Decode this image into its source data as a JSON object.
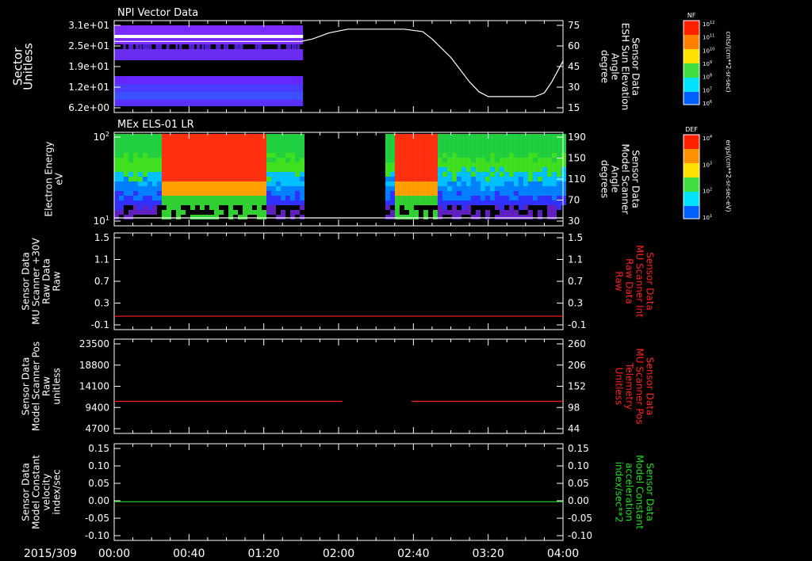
{
  "date_label": "2015/309",
  "time_ticks": [
    "00:00",
    "00:40",
    "01:20",
    "02:00",
    "02:40",
    "03:20",
    "04:00"
  ],
  "colors": {
    "axis": "#ffffff",
    "red": "#ff2020",
    "green": "#20e020",
    "white": "#ffffff"
  },
  "chart_data": [
    {
      "type": "heatmap",
      "title": "NPI Vector Data",
      "ylabel": [
        "Sector",
        "Unitless"
      ],
      "yticks": [
        "3.1e+01",
        "2.5e+01",
        "1.9e+01",
        "1.2e+01",
        "6.2e+00"
      ],
      "overlay": {
        "type": "line",
        "ylabel": [
          "Sensor Data",
          "ESH Sun Elevation",
          "Angle",
          "degree"
        ],
        "yticks": [
          "75",
          "60",
          "45",
          "30",
          "15"
        ],
        "ylim": [
          0,
          75
        ],
        "x_minutes": [
          0,
          100,
          106,
          115,
          125,
          140,
          145,
          155,
          165,
          170,
          180,
          190,
          195,
          200,
          210,
          220,
          225,
          230,
          234,
          240
        ],
        "y": [
          58,
          58,
          60,
          65,
          68,
          68,
          68,
          68,
          66,
          60,
          45,
          25,
          17,
          13,
          13,
          13,
          13,
          16,
          25,
          42
        ]
      },
      "colorbar": {
        "label": "NF",
        "units": "cnts/(cm**2-sr-sec)",
        "ticks": [
          "10^12",
          "10^11",
          "10^10",
          "10^9",
          "10^8",
          "10^7",
          "10^6"
        ]
      }
    },
    {
      "type": "heatmap",
      "title": "MEx ELS-01 LR",
      "ylabel": [
        "Electron Energy",
        "eV"
      ],
      "yticks": [
        "10^2",
        "10^1"
      ],
      "overlay": {
        "type": "line",
        "ylabel": [
          "Sensor Data",
          "Model Scanner",
          "Angle",
          "degrees"
        ],
        "yticks": [
          "190",
          "150",
          "110",
          "70",
          "30"
        ],
        "ylim": [
          0,
          190
        ],
        "x_minutes": [
          0,
          240
        ],
        "y": [
          0,
          0
        ]
      },
      "colorbar": {
        "label": "DEF",
        "units": "ergs/(cm**2-sr-sec-eV)",
        "ticks": [
          "10^4",
          "10^3",
          "10^2",
          "10^1"
        ]
      }
    },
    {
      "type": "line",
      "ylabel": [
        "Sensor Data",
        "MU Scanner +30V",
        "Raw Data",
        "Raw"
      ],
      "yticks": [
        "1.5",
        "1.1",
        "0.7",
        "0.3",
        "-0.1"
      ],
      "ylim": [
        -0.3,
        1.5
      ],
      "right_label": [
        "Sensor Data",
        "MU Scanner Int",
        "Raw Data",
        "Raw"
      ],
      "right_yticks": [
        "1.5",
        "1.1",
        "0.7",
        "0.3",
        "-0.1"
      ],
      "series": [
        {
          "color": "red",
          "segments": [
            {
              "x": [
                0,
                240
              ],
              "y": [
                -0.05,
                -0.05
              ]
            }
          ]
        }
      ]
    },
    {
      "type": "line",
      "ylabel": [
        "Sensor Data",
        "Model Scanner Pos",
        "Raw",
        "unitless"
      ],
      "yticks": [
        "23500",
        "18800",
        "14100",
        "9400",
        "4700"
      ],
      "ylim": [
        0,
        23500
      ],
      "right_label": [
        "Sensor Data",
        "MU Scanner Pos",
        "Telemetry",
        "Unitless"
      ],
      "right_yticks": [
        "260",
        "206",
        "152",
        "98",
        "44"
      ],
      "series": [
        {
          "color": "red",
          "segments": [
            {
              "x": [
                0,
                122
              ],
              "y": [
                8000,
                8000
              ]
            },
            {
              "x": [
                159,
                240
              ],
              "y": [
                8000,
                8000
              ]
            }
          ]
        }
      ]
    },
    {
      "type": "line",
      "ylabel": [
        "Sensor Data",
        "Model Constant",
        "velocity",
        "index/sec"
      ],
      "yticks": [
        "0.15",
        "0.10",
        "0.05",
        "0.00",
        "-0.05",
        "-0.10"
      ],
      "ylim": [
        -0.1,
        0.15
      ],
      "right_label": [
        "Sensor Data",
        "Model Constant",
        "acceleration",
        "index/sec**2"
      ],
      "right_yticks": [
        "0.15",
        "0.10",
        "0.05",
        "0.00",
        "-0.05",
        "-0.10"
      ],
      "series": [
        {
          "color": "green",
          "segments": [
            {
              "x": [
                0,
                240
              ],
              "y": [
                0,
                0
              ]
            }
          ]
        }
      ]
    }
  ]
}
